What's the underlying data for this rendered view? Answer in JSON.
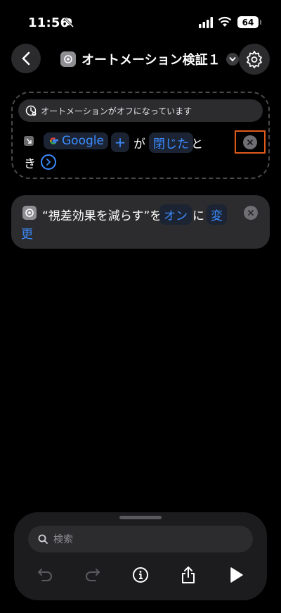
{
  "status_bar": {
    "time": "11:56",
    "battery": "64"
  },
  "header": {
    "title": "オートメーション検証１"
  },
  "trigger": {
    "status_banner": "オートメーションがオフになっています",
    "app_name": "Google",
    "plus": "+",
    "particle_ga": "が",
    "state": "閉じた",
    "particle_to": "と",
    "particle_ki": "き"
  },
  "action": {
    "label": "“視差効果を減らす”を",
    "value": "オン",
    "particle": "に",
    "verb_part1": "変",
    "verb_part2": "更"
  },
  "bottom_sheet": {
    "search_placeholder": "検索"
  },
  "colors": {
    "accent": "#3b8cff",
    "highlight": "#e05a1c",
    "card": "#2c2c2e"
  }
}
